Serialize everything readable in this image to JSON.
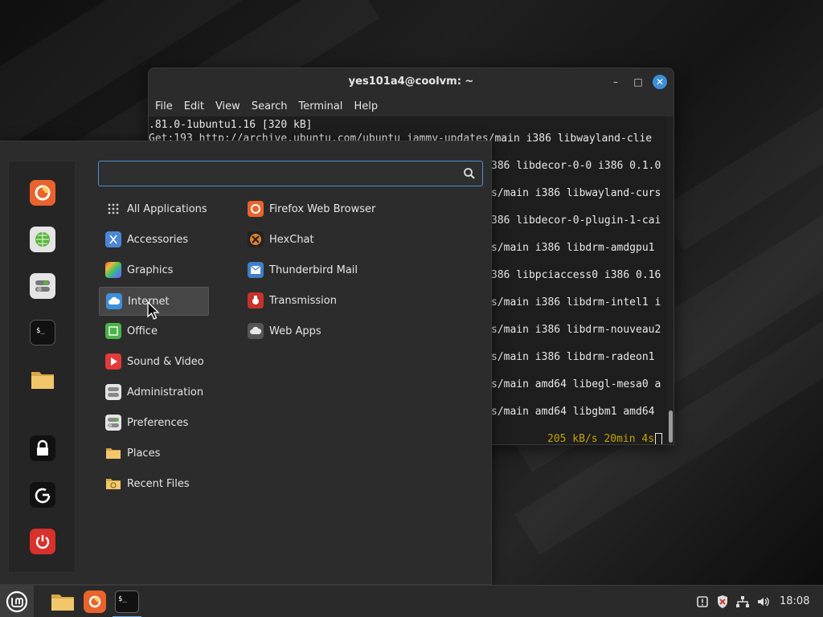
{
  "terminal": {
    "title": "yes101a4@coolvm: ~",
    "menu": [
      "File",
      "Edit",
      "View",
      "Search",
      "Terminal",
      "Help"
    ],
    "lines": [
      ".81.0-1ubuntu1.16 [320 kB]",
      "Get:193 http://archive.ubuntu.com/ubuntu jammy-updates/main i386 libwayland-clie",
      "386 libdecor-0-0 i386 0.1.0",
      "s/main i386 libwayland-curs",
      "386 libdecor-0-plugin-1-cai",
      "s/main i386 libdrm-amdgpu1",
      "386 libpciaccess0 i386 0.16",
      "s/main i386 libdrm-intel1 i",
      "s/main i386 libdrm-nouveau2",
      "s/main i386 libdrm-radeon1",
      "s/main amd64 libegl-mesa0 a",
      "s/main amd64 libgbm1 amd64"
    ],
    "status": "205 kB/s 20min 4s",
    "window_buttons": {
      "minimize": "–",
      "maximize": "□",
      "close": "✕"
    }
  },
  "start_menu": {
    "search": {
      "value": "",
      "placeholder": ""
    },
    "favorites": [
      {
        "name": "firefox-icon"
      },
      {
        "name": "software-manager-icon"
      },
      {
        "name": "settings-toggle-icon"
      },
      {
        "name": "terminal-icon"
      },
      {
        "name": "files-folder-icon"
      },
      {
        "name": "lock-screen-icon"
      },
      {
        "name": "logout-icon"
      },
      {
        "name": "power-icon"
      }
    ],
    "categories": [
      {
        "label": "All Applications",
        "icon": "grid-icon"
      },
      {
        "label": "Accessories",
        "icon": "accessories-icon"
      },
      {
        "label": "Graphics",
        "icon": "graphics-icon"
      },
      {
        "label": "Internet",
        "icon": "internet-icon"
      },
      {
        "label": "Office",
        "icon": "office-icon"
      },
      {
        "label": "Sound & Video",
        "icon": "sound-video-icon"
      },
      {
        "label": "Administration",
        "icon": "administration-icon"
      },
      {
        "label": "Preferences",
        "icon": "preferences-icon"
      },
      {
        "label": "Places",
        "icon": "places-folder-icon"
      },
      {
        "label": "Recent Files",
        "icon": "recent-files-icon"
      }
    ],
    "selected_category": "Internet",
    "apps": [
      {
        "label": "Firefox Web Browser",
        "icon": "firefox-icon"
      },
      {
        "label": "HexChat",
        "icon": "hexchat-icon"
      },
      {
        "label": "Thunderbird Mail",
        "icon": "thunderbird-icon"
      },
      {
        "label": "Transmission",
        "icon": "transmission-icon"
      },
      {
        "label": "Web Apps",
        "icon": "web-apps-icon"
      }
    ]
  },
  "taskbar": {
    "clock": "18:08",
    "active_item": "terminal"
  },
  "colors": {
    "accent": "#4a8fd8",
    "firefox": "#e8642c",
    "power": "#d9312b",
    "terminal_status": "#c2a200"
  }
}
